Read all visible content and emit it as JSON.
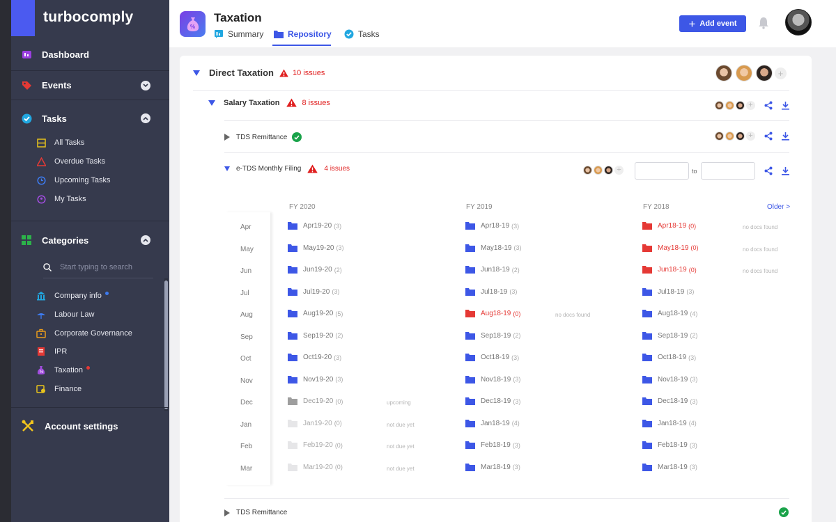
{
  "app": {
    "logo": "turbocomply"
  },
  "sidebar": {
    "dashboard": "Dashboard",
    "events": "Events",
    "tasks": "Tasks",
    "task_items": [
      "All Tasks",
      "Overdue Tasks",
      "Upcoming Tasks",
      "My Tasks"
    ],
    "categories": "Categories",
    "search_placeholder": "Start typing to search",
    "category_items": [
      "Company info",
      "Labour Law",
      "Corporate Governance",
      "IPR",
      "Taxation",
      "Finance"
    ],
    "account_settings": "Account settings"
  },
  "header": {
    "title": "Taxation",
    "tabs": [
      "Summary",
      "Repository",
      "Tasks"
    ],
    "active_tab": "Repository",
    "add_event": "Add event"
  },
  "colors": {
    "accent": "#3d57e6",
    "danger": "#e01e1e",
    "success": "#1aa34a",
    "sidebar": "#363a4d"
  },
  "tree": {
    "direct": {
      "label": "Direct Taxation",
      "issues": "10 issues"
    },
    "salary": {
      "label": "Salary Taxation",
      "issues": "8 issues"
    },
    "tds": {
      "label": "TDS Remittance"
    },
    "etds": {
      "label": "e-TDS Monthly Filing",
      "issues": "4 issues",
      "to": "to"
    },
    "tds_bottom": {
      "label": "TDS Remittance"
    }
  },
  "repository": {
    "fy_headers": [
      "FY 2020",
      "FY 2019",
      "FY 2018"
    ],
    "older": "Older >",
    "months": [
      "Apr",
      "May",
      "Jun",
      "Jul",
      "Aug",
      "Sep",
      "Oct",
      "Nov",
      "Dec",
      "Jan",
      "Feb",
      "Mar"
    ],
    "fy2020": [
      {
        "name": "Apr19-20",
        "count": "(3)",
        "status": "ok",
        "note": ""
      },
      {
        "name": "May19-20",
        "count": "(3)",
        "status": "ok",
        "note": ""
      },
      {
        "name": "Jun19-20",
        "count": "(2)",
        "status": "ok",
        "note": ""
      },
      {
        "name": "Jul19-20",
        "count": "(3)",
        "status": "ok",
        "note": ""
      },
      {
        "name": "Aug19-20",
        "count": "(5)",
        "status": "ok",
        "note": ""
      },
      {
        "name": "Sep19-20",
        "count": "(2)",
        "status": "ok",
        "note": ""
      },
      {
        "name": "Oct19-20",
        "count": "(3)",
        "status": "ok",
        "note": ""
      },
      {
        "name": "Nov19-20",
        "count": "(3)",
        "status": "ok",
        "note": ""
      },
      {
        "name": "Dec19-20",
        "count": "(0)",
        "status": "upcoming",
        "note": "upcoming"
      },
      {
        "name": "Jan19-20",
        "count": "(0)",
        "status": "notdue",
        "note": "not due yet"
      },
      {
        "name": "Feb19-20",
        "count": "(0)",
        "status": "notdue",
        "note": "not due yet"
      },
      {
        "name": "Mar19-20",
        "count": "(0)",
        "status": "notdue",
        "note": "not due yet"
      }
    ],
    "fy2019": [
      {
        "name": "Apr18-19",
        "count": "(3)",
        "status": "ok",
        "note": ""
      },
      {
        "name": "May18-19",
        "count": "(3)",
        "status": "ok",
        "note": ""
      },
      {
        "name": "Jun18-19",
        "count": "(2)",
        "status": "ok",
        "note": ""
      },
      {
        "name": "Jul18-19",
        "count": "(3)",
        "status": "ok",
        "note": ""
      },
      {
        "name": "Aug18-19",
        "count": "(0)",
        "status": "missing",
        "note": "no docs found"
      },
      {
        "name": "Sep18-19",
        "count": "(2)",
        "status": "ok",
        "note": ""
      },
      {
        "name": "Oct18-19",
        "count": "(3)",
        "status": "ok",
        "note": ""
      },
      {
        "name": "Nov18-19",
        "count": "(3)",
        "status": "ok",
        "note": ""
      },
      {
        "name": "Dec18-19",
        "count": "(3)",
        "status": "ok",
        "note": ""
      },
      {
        "name": "Jan18-19",
        "count": "(4)",
        "status": "ok",
        "note": ""
      },
      {
        "name": "Feb18-19",
        "count": "(3)",
        "status": "ok",
        "note": ""
      },
      {
        "name": "Mar18-19",
        "count": "(3)",
        "status": "ok",
        "note": ""
      }
    ],
    "fy2018": [
      {
        "name": "Apr18-19",
        "count": "(0)",
        "status": "missing",
        "note": "no docs found"
      },
      {
        "name": "May18-19",
        "count": "(0)",
        "status": "missing",
        "note": "no docs found"
      },
      {
        "name": "Jun18-19",
        "count": "(0)",
        "status": "missing",
        "note": "no docs found"
      },
      {
        "name": "Jul18-19",
        "count": "(3)",
        "status": "ok",
        "note": ""
      },
      {
        "name": "Aug18-19",
        "count": "(4)",
        "status": "ok",
        "note": ""
      },
      {
        "name": "Sep18-19",
        "count": "(2)",
        "status": "ok",
        "note": ""
      },
      {
        "name": "Oct18-19",
        "count": "(3)",
        "status": "ok",
        "note": ""
      },
      {
        "name": "Nov18-19",
        "count": "(3)",
        "status": "ok",
        "note": ""
      },
      {
        "name": "Dec18-19",
        "count": "(3)",
        "status": "ok",
        "note": ""
      },
      {
        "name": "Jan18-19",
        "count": "(4)",
        "status": "ok",
        "note": ""
      },
      {
        "name": "Feb18-19",
        "count": "(3)",
        "status": "ok",
        "note": ""
      },
      {
        "name": "Mar18-19",
        "count": "(3)",
        "status": "ok",
        "note": ""
      }
    ]
  }
}
